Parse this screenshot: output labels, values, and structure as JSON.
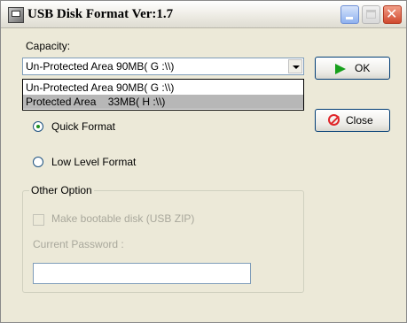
{
  "window": {
    "title": "USB Disk Format Ver:1.7"
  },
  "capacity": {
    "label": "Capacity:",
    "selected": "Un-Protected Area 90MB( G :\\\\)",
    "options": [
      "Un-Protected Area 90MB( G :\\\\)",
      "Protected Area    33MB( H :\\\\)"
    ]
  },
  "buttons": {
    "ok": "OK",
    "close": "Close"
  },
  "format_options": {
    "quick": "Quick Format",
    "low_level": "Low  Level Format",
    "selected": "quick"
  },
  "other_option": {
    "title": "Other Option",
    "bootable_label": "Make bootable disk (USB ZIP)",
    "bootable_checked": false,
    "password_label": "Current Password :",
    "password_value": ""
  },
  "colors": {
    "ok_icon": "#17a01c",
    "close_icon": "#e0262a",
    "highlight": "#b7b7b7"
  },
  "icons": [
    "app-icon",
    "minimize-icon",
    "maximize-icon",
    "close-icon",
    "play-icon",
    "no-entry-icon",
    "chevron-down-icon"
  ]
}
